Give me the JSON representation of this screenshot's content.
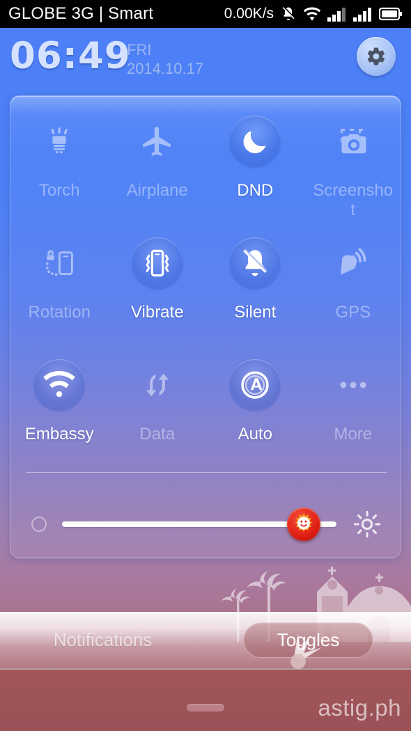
{
  "statusbar": {
    "carrier": "GLOBE 3G | Smart",
    "network_speed": "0.00K/s",
    "icons": [
      "bell-muted-icon",
      "wifi-icon",
      "signal-bars-icon",
      "signal-bars-icon",
      "battery-icon"
    ],
    "background": "#000000",
    "text_color": "#ffffff"
  },
  "header": {
    "time": "06:49",
    "weekday": "FRI",
    "date": "2014.10.17",
    "settings_icon": "gear-icon",
    "time_color": "#d5e2ff",
    "date_color": "#9db6f3"
  },
  "toggles": [
    {
      "label": "Torch",
      "icon": "torch-icon",
      "active": false
    },
    {
      "label": "Airplane",
      "icon": "airplane-icon",
      "active": false
    },
    {
      "label": "DND",
      "icon": "moon-icon",
      "active": true
    },
    {
      "label": "Screenshot",
      "icon": "screenshot-icon",
      "active": false
    },
    {
      "label": "Rotation",
      "icon": "rotation-lock-icon",
      "active": false
    },
    {
      "label": "Vibrate",
      "icon": "vibrate-icon",
      "active": true
    },
    {
      "label": "Silent",
      "icon": "bell-muted-icon",
      "active": true
    },
    {
      "label": "GPS",
      "icon": "gps-icon",
      "active": false
    },
    {
      "label": "Embassy",
      "icon": "wifi-icon",
      "active": true
    },
    {
      "label": "Data",
      "icon": "data-sync-icon",
      "active": false
    },
    {
      "label": "Auto",
      "icon": "auto-brightness-icon",
      "active": true
    },
    {
      "label": "More",
      "icon": "more-dots-icon",
      "active": false
    }
  ],
  "brightness": {
    "left_icon": "dim-circle-icon",
    "right_icon": "sun-icon",
    "thumb_icon": "sun-face-icon",
    "value_percent": 88,
    "thumb_color": "#df1f14",
    "track_color": "#ffffff"
  },
  "scenery": {
    "elements": [
      "palm-tree-icon",
      "palm-tree-icon",
      "church-silhouette-icon"
    ]
  },
  "tabs": [
    {
      "label": "Notifications",
      "active": false
    },
    {
      "label": "Toggles",
      "active": true
    }
  ],
  "footer": {
    "watermark": "astig.ph",
    "handle": "drag-handle"
  },
  "colors": {
    "panel_accent": "#ffffff",
    "bg_top": "#4d80f6",
    "bg_bottom": "#a46266",
    "active_label": "#ffffff",
    "inactive_label": "rgba(232,238,255,.46)"
  }
}
